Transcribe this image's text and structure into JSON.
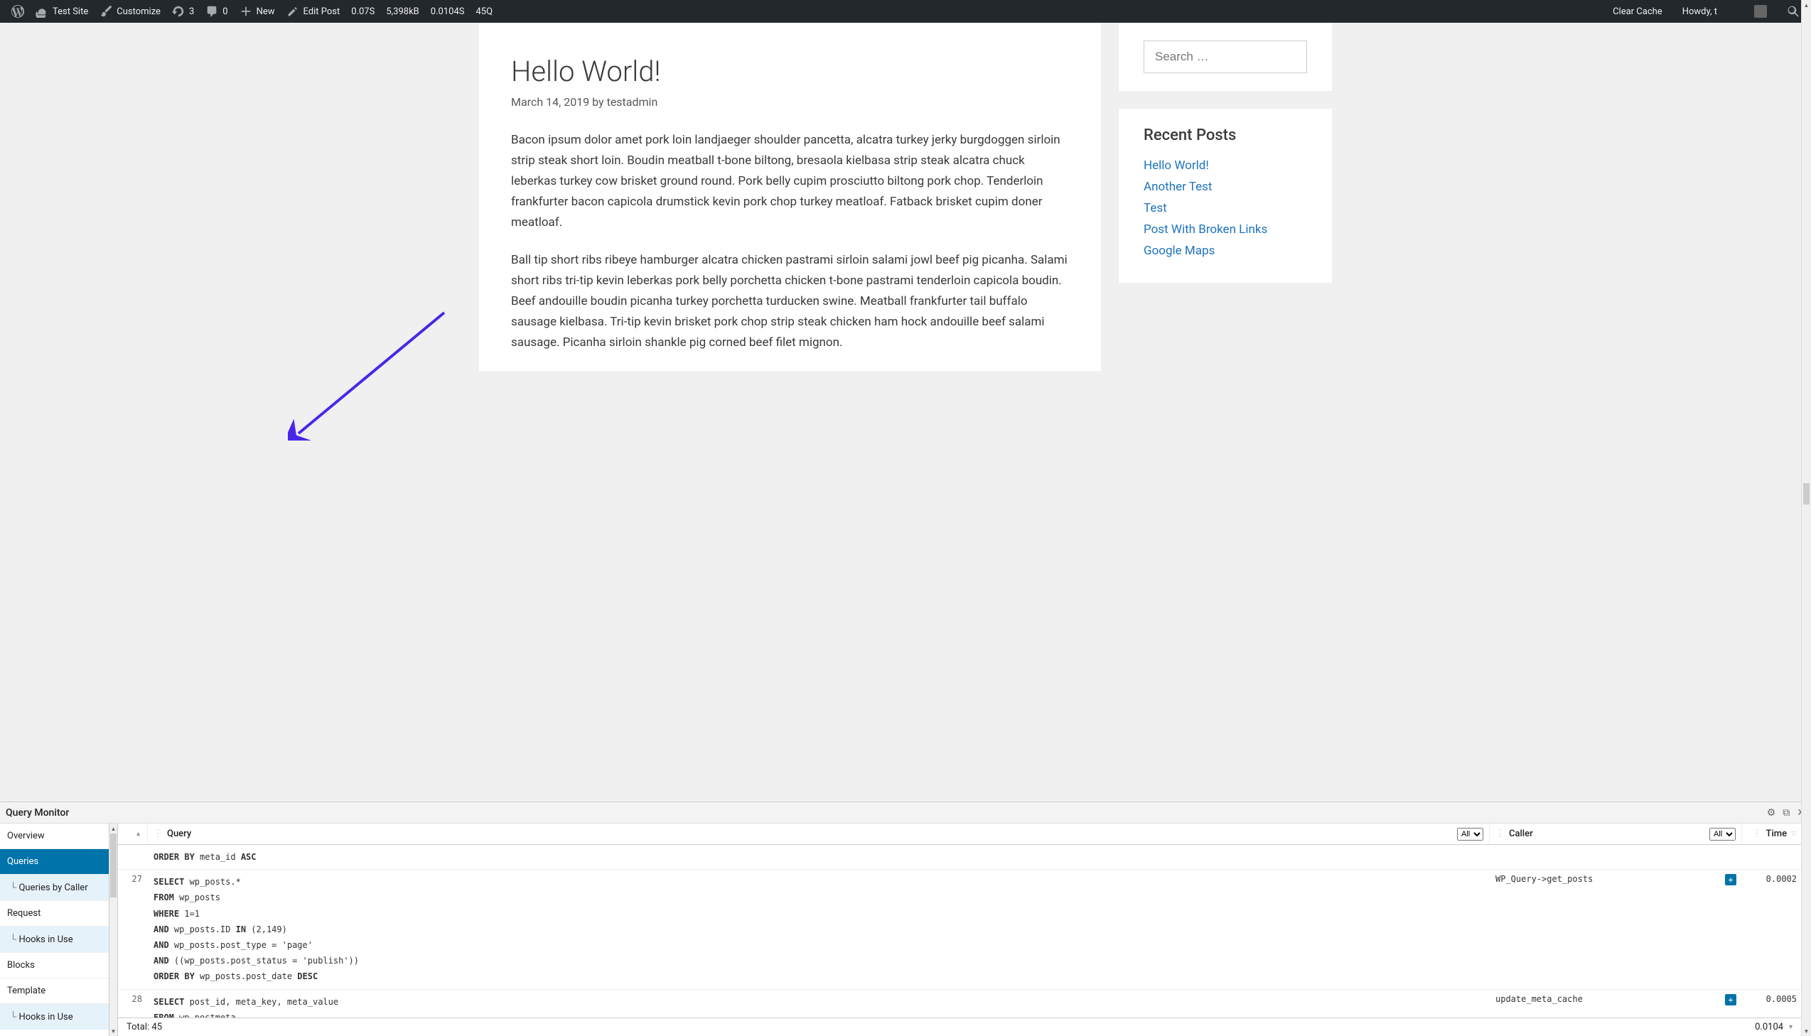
{
  "adminBar": {
    "siteName": "Test Site",
    "customize": "Customize",
    "updates": "3",
    "comments": "0",
    "newLabel": "New",
    "editPost": "Edit Post",
    "stats": {
      "time1": "0.07S",
      "memory": "5,398kB",
      "time2": "0.0104S",
      "queries": "45Q"
    },
    "clearCache": "Clear Cache",
    "howdy": "Howdy, t"
  },
  "post": {
    "title": "Hello World!",
    "metaDate": "March 14, 2019",
    "metaBy": "by",
    "metaAuthor": "testadmin",
    "para1": "Bacon ipsum dolor amet pork loin landjaeger shoulder pancetta, alcatra turkey jerky burgdoggen sirloin strip steak short loin. Boudin meatball t-bone biltong, bresaola kielbasa strip steak alcatra chuck leberkas turkey cow brisket ground round. Pork belly cupim prosciutto biltong pork chop. Tenderloin frankfurter bacon capicola drumstick kevin pork chop turkey meatloaf. Fatback brisket cupim doner meatloaf.",
    "para2": "Ball tip short ribs ribeye hamburger alcatra chicken pastrami sirloin salami jowl beef pig picanha. Salami short ribs tri-tip kevin leberkas pork belly porchetta chicken t-bone pastrami tenderloin capicola boudin. Beef andouille boudin picanha turkey porchetta turducken swine. Meatball frankfurter tail buffalo sausage kielbasa. Tri-tip kevin brisket pork chop strip steak chicken ham hock andouille beef salami sausage. Picanha sirloin shankle pig corned beef filet mignon."
  },
  "sidebar": {
    "searchPlaceholder": "Search …",
    "recentTitle": "Recent Posts",
    "recentPosts": [
      "Hello World!",
      "Another Test",
      "Test",
      "Post With Broken Links",
      "Google Maps"
    ]
  },
  "qm": {
    "title": "Query Monitor",
    "nav": {
      "overview": "Overview",
      "queries": "Queries",
      "queriesByCaller": "Queries by Caller",
      "request": "Request",
      "hooksInUse": "Hooks in Use",
      "blocks": "Blocks",
      "template": "Template",
      "hooksInUse2": "Hooks in Use"
    },
    "columns": {
      "query": "Query",
      "caller": "Caller",
      "time": "Time"
    },
    "filterAll": "All",
    "rowFragment": "ORDER BY meta_id ASC",
    "rows": [
      {
        "num": "27",
        "sql": "SELECT wp_posts.*\nFROM wp_posts\nWHERE 1=1\nAND wp_posts.ID IN (2,149)\nAND wp_posts.post_type = 'page'\nAND ((wp_posts.post_status = 'publish'))\nORDER BY wp_posts.post_date DESC",
        "caller": "WP_Query->get_posts",
        "time": "0.0002"
      },
      {
        "num": "28",
        "sql": "SELECT post_id, meta_key, meta_value\nFROM wp_postmeta",
        "caller": "update_meta_cache",
        "time": "0.0005"
      }
    ],
    "footer": {
      "total": "Total: 45",
      "time": "0.0104"
    }
  }
}
